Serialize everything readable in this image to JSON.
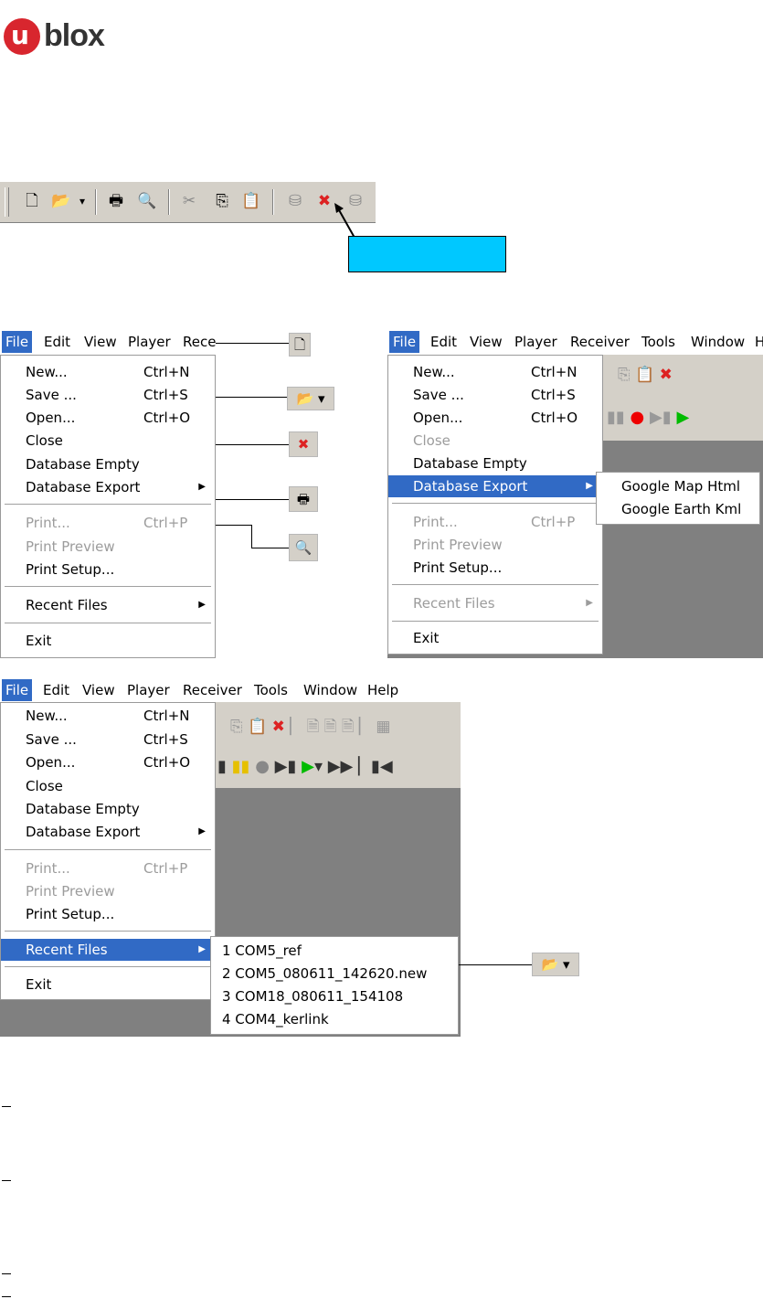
{
  "logo": {
    "text": "blox",
    "u": "u"
  },
  "toolbar": {
    "buttons": [
      {
        "name": "new-icon",
        "glyph": "🗋"
      },
      {
        "name": "open-icon",
        "glyph": "📂"
      },
      {
        "name": "dropdown-icon",
        "glyph": "▾"
      },
      {
        "name": "print-icon",
        "glyph": "🖶"
      },
      {
        "name": "print-preview-icon",
        "glyph": "🔍"
      },
      {
        "name": "cut-icon",
        "glyph": "✂"
      },
      {
        "name": "copy-icon",
        "glyph": "⎘"
      },
      {
        "name": "paste-icon",
        "glyph": "📋"
      },
      {
        "name": "db-icon",
        "glyph": "⛁"
      },
      {
        "name": "close-db-icon",
        "glyph": "✖"
      },
      {
        "name": "db-export-icon",
        "glyph": "⛁"
      }
    ]
  },
  "menubar": {
    "a": [
      "File",
      "Edit",
      "View",
      "Player",
      "Rece"
    ],
    "b": [
      "File",
      "Edit",
      "View",
      "Player",
      "Receiver",
      "Tools",
      "Window",
      "H"
    ],
    "c": [
      "File",
      "Edit",
      "View",
      "Player",
      "Receiver",
      "Tools",
      "Window",
      "Help"
    ]
  },
  "file_menu": {
    "new": "New...",
    "new_sc": "Ctrl+N",
    "save": "Save ...",
    "save_sc": "Ctrl+S",
    "open": "Open...",
    "open_sc": "Ctrl+O",
    "close": "Close",
    "db_empty": "Database Empty",
    "db_export": "Database Export",
    "print": "Print...",
    "print_sc": "Ctrl+P",
    "print_preview": "Print Preview",
    "print_setup": "Print Setup...",
    "recent": "Recent Files",
    "exit": "Exit"
  },
  "export_submenu": [
    "Google Map Html",
    "Google Earth Kml"
  ],
  "recent_submenu": [
    "1 COM5_ref",
    "2 COM5_080611_142620.new",
    "3 COM18_080611_154108",
    "4 COM4_kerlink"
  ],
  "colors": {
    "accent": "#316ac5",
    "callout": "#00c8ff",
    "brand": "#d8262e"
  }
}
